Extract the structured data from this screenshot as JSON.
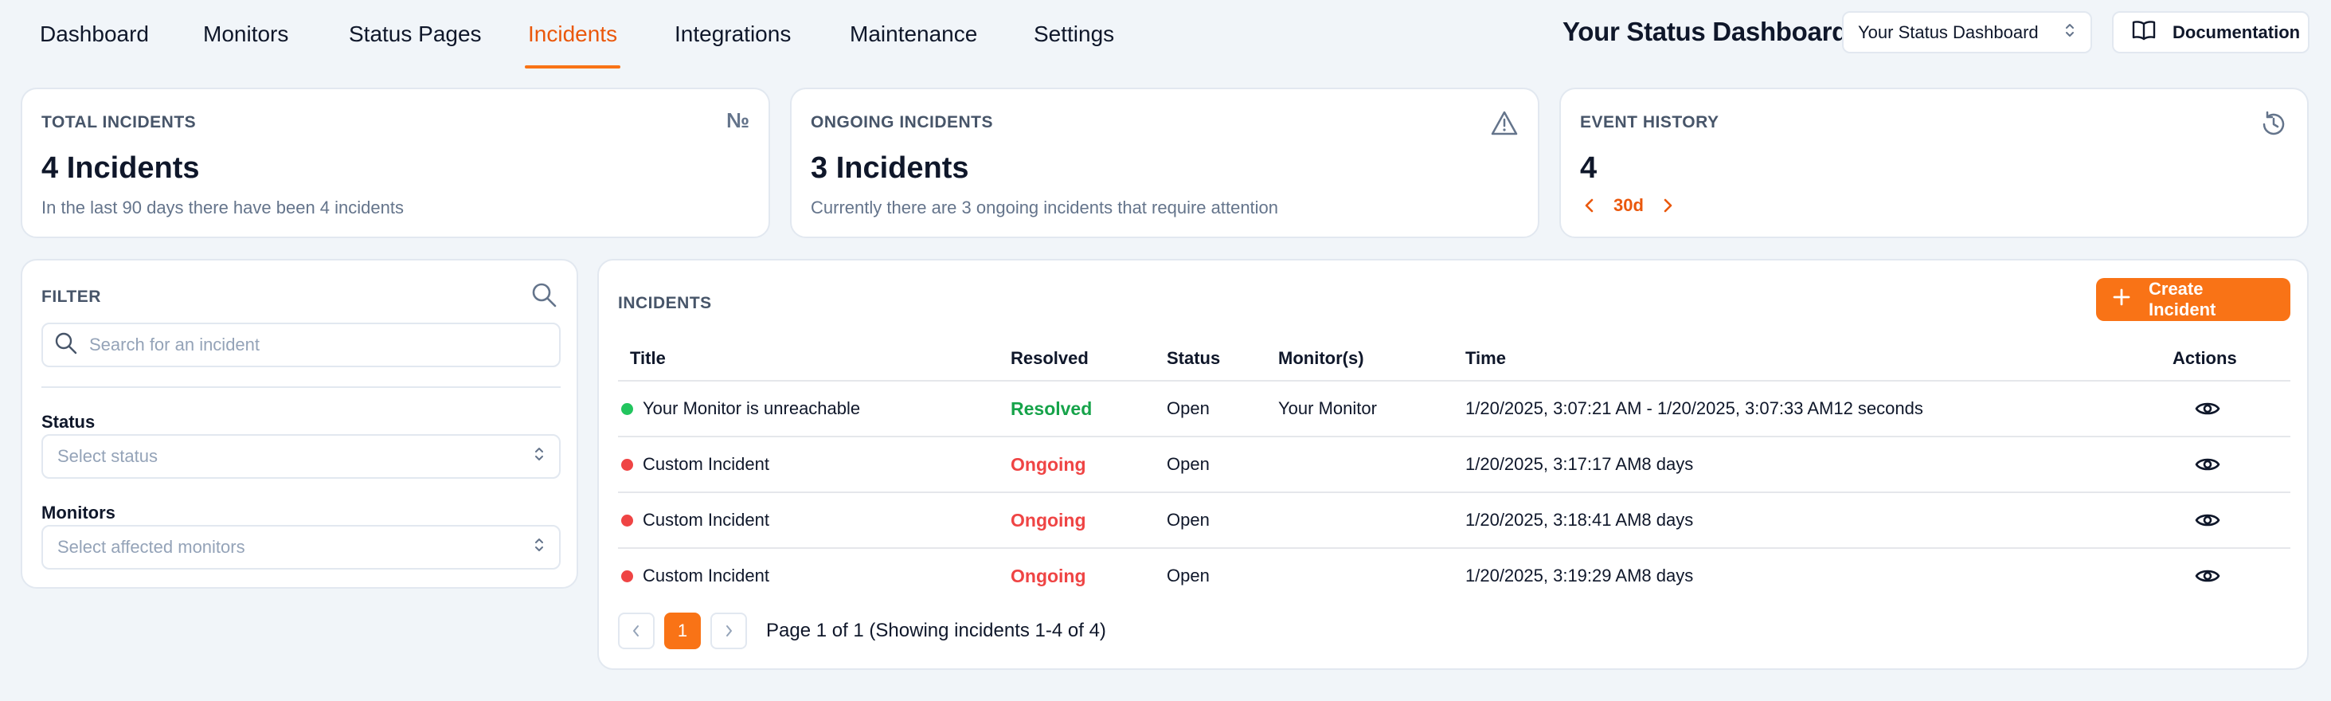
{
  "nav": {
    "tabs": [
      {
        "label": "Dashboard"
      },
      {
        "label": "Monitors"
      },
      {
        "label": "Status Pages"
      },
      {
        "label": "Incidents",
        "active": true
      },
      {
        "label": "Integrations"
      },
      {
        "label": "Maintenance"
      },
      {
        "label": "Settings"
      }
    ],
    "brand": "Your Status Dashboard",
    "org_select": {
      "value": "Your Status Dashboard"
    },
    "documentation_label": "Documentation"
  },
  "cards": {
    "total": {
      "label": "TOTAL INCIDENTS",
      "icon_glyph": "№",
      "value": "4 Incidents",
      "description": "In the last 90 days there have been 4 incidents"
    },
    "ongoing": {
      "label": "ONGOING INCIDENTS",
      "icon": "warning-triangle-icon",
      "value": "3 Incidents",
      "description": "Currently there are 3 ongoing incidents that require attention"
    },
    "history": {
      "label": "EVENT HISTORY",
      "icon": "history-icon",
      "value": "4",
      "range": "30d"
    }
  },
  "filter": {
    "title": "FILTER",
    "search_placeholder": "Search for an incident",
    "status_label": "Status",
    "status_placeholder": "Select status",
    "monitors_label": "Monitors",
    "monitors_placeholder": "Select affected monitors"
  },
  "incidents": {
    "title": "INCIDENTS",
    "create_label": "Create Incident",
    "columns": {
      "title": "Title",
      "resolved": "Resolved",
      "status": "Status",
      "monitors": "Monitor(s)",
      "time": "Time",
      "actions": "Actions"
    },
    "rows": [
      {
        "title": "Your Monitor is unreachable",
        "resolved": "Resolved",
        "status": "Open",
        "monitors": "Your Monitor",
        "time": "1/20/2025, 3:07:21 AM - 1/20/2025, 3:07:33 AM12 seconds",
        "dot_color": "#22c55e",
        "resolved_state": "resolved"
      },
      {
        "title": "Custom Incident",
        "resolved": "Ongoing",
        "status": "Open",
        "monitors": "",
        "time": "1/20/2025, 3:17:17 AM8 days",
        "dot_color": "#ef4444",
        "resolved_state": "ongoing"
      },
      {
        "title": "Custom Incident",
        "resolved": "Ongoing",
        "status": "Open",
        "monitors": "",
        "time": "1/20/2025, 3:18:41 AM8 days",
        "dot_color": "#ef4444",
        "resolved_state": "ongoing"
      },
      {
        "title": "Custom Incident",
        "resolved": "Ongoing",
        "status": "Open",
        "monitors": "",
        "time": "1/20/2025, 3:19:29 AM8 days",
        "dot_color": "#ef4444",
        "resolved_state": "ongoing"
      }
    ],
    "pagination": {
      "current_page": "1",
      "info": "Page 1 of 1 (Showing incidents 1-4 of 4)"
    }
  },
  "colors": {
    "accent": "#f97316",
    "accent_text": "#ea580c",
    "resolved": "#16a34a",
    "ongoing": "#ef4444",
    "background": "#f1f5f9"
  }
}
